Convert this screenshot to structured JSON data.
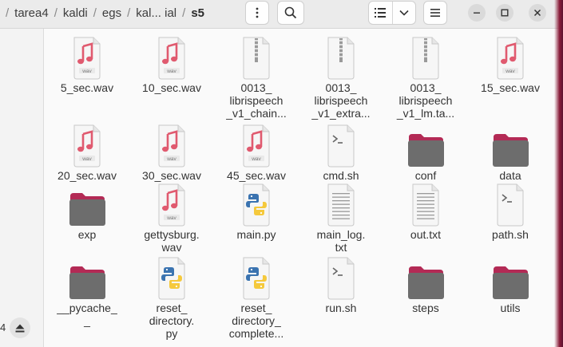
{
  "breadcrumbs": [
    "tarea4",
    "kaldi",
    "egs",
    "kal... ial",
    "s5"
  ],
  "header_icons": {
    "more": "more-vertical-icon",
    "search": "search-icon",
    "view_list": "list-view-icon",
    "view_options": "chevron-down-icon",
    "menu": "hamburger-menu-icon",
    "minimize": "minimize-icon",
    "maximize": "maximize-icon",
    "close": "close-icon"
  },
  "sidebar": {
    "storage_label": "4",
    "eject_icon": "eject-icon"
  },
  "colors": {
    "folder_top": "#b32a55",
    "folder_body": "#6d6d6d",
    "audio_note": "#e05a6f",
    "accent_edge": "#8a1d3a"
  },
  "files": [
    {
      "name_lines": [
        "5_sec.wav"
      ],
      "type": "audio",
      "icon": "audio-wav-icon"
    },
    {
      "name_lines": [
        "10_sec.wav"
      ],
      "type": "audio",
      "icon": "audio-wav-icon"
    },
    {
      "name_lines": [
        "0013_",
        "librispeech",
        "_v1_chain..."
      ],
      "type": "archive",
      "icon": "archive-zip-icon"
    },
    {
      "name_lines": [
        "0013_",
        "librispeech",
        "_v1_extra..."
      ],
      "type": "archive",
      "icon": "archive-zip-icon"
    },
    {
      "name_lines": [
        "0013_",
        "librispeech",
        "_v1_lm.ta..."
      ],
      "type": "archive",
      "icon": "archive-zip-icon"
    },
    {
      "name_lines": [
        "15_sec.wav"
      ],
      "type": "audio",
      "icon": "audio-wav-icon"
    },
    {
      "name_lines": [
        "20_sec.wav"
      ],
      "type": "audio",
      "icon": "audio-wav-icon"
    },
    {
      "name_lines": [
        "30_sec.wav"
      ],
      "type": "audio",
      "icon": "audio-wav-icon"
    },
    {
      "name_lines": [
        "45_sec.wav"
      ],
      "type": "audio",
      "icon": "audio-wav-icon"
    },
    {
      "name_lines": [
        "cmd.sh"
      ],
      "type": "script",
      "icon": "shell-script-icon"
    },
    {
      "name_lines": [
        "conf"
      ],
      "type": "folder",
      "icon": "folder-icon"
    },
    {
      "name_lines": [
        "data"
      ],
      "type": "folder",
      "icon": "folder-icon"
    },
    {
      "name_lines": [
        "exp"
      ],
      "type": "folder",
      "icon": "folder-icon"
    },
    {
      "name_lines": [
        "gettysburg.",
        "wav"
      ],
      "type": "audio",
      "icon": "audio-wav-icon"
    },
    {
      "name_lines": [
        "main.py"
      ],
      "type": "python",
      "icon": "python-file-icon"
    },
    {
      "name_lines": [
        "main_log.",
        "txt"
      ],
      "type": "text",
      "icon": "text-file-icon"
    },
    {
      "name_lines": [
        "out.txt"
      ],
      "type": "text",
      "icon": "text-file-icon"
    },
    {
      "name_lines": [
        "path.sh"
      ],
      "type": "script",
      "icon": "shell-script-icon"
    },
    {
      "name_lines": [
        "__pycache_",
        "_"
      ],
      "type": "folder",
      "icon": "folder-icon"
    },
    {
      "name_lines": [
        "reset_",
        "directory.",
        "py"
      ],
      "type": "python",
      "icon": "python-file-icon"
    },
    {
      "name_lines": [
        "reset_",
        "directory_",
        "complete..."
      ],
      "type": "python",
      "icon": "python-file-icon"
    },
    {
      "name_lines": [
        "run.sh"
      ],
      "type": "script",
      "icon": "shell-script-icon"
    },
    {
      "name_lines": [
        "steps"
      ],
      "type": "folder",
      "icon": "folder-icon"
    },
    {
      "name_lines": [
        "utils"
      ],
      "type": "folder",
      "icon": "folder-icon"
    }
  ]
}
